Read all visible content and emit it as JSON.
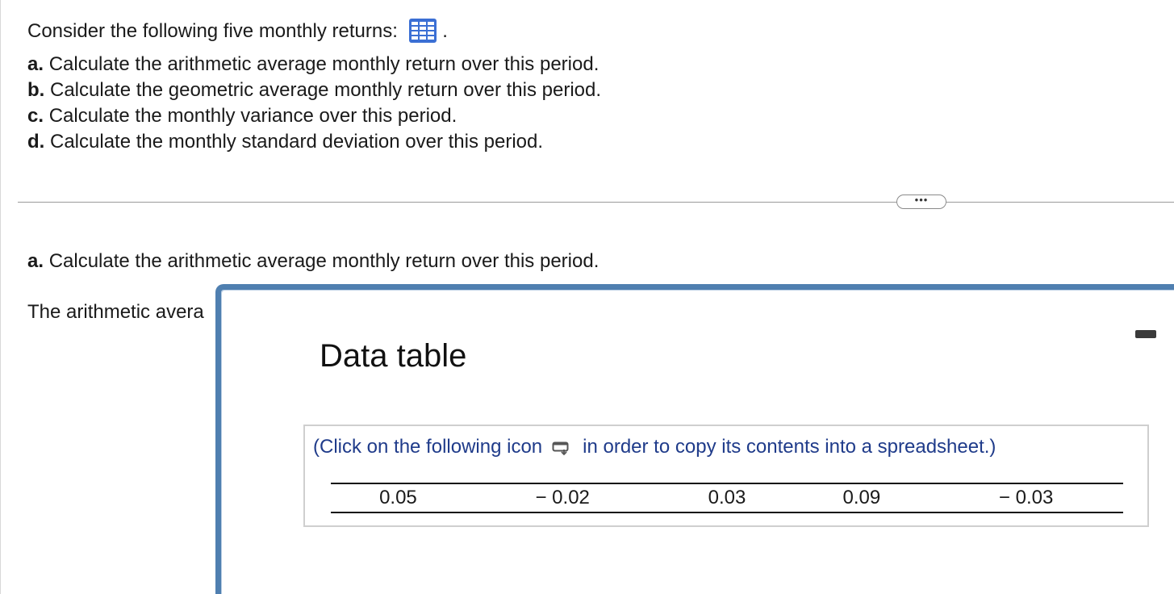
{
  "question": {
    "intro": "Consider the following five monthly returns:",
    "intro_suffix": ".",
    "parts": [
      {
        "letter": "a.",
        "text": "Calculate the arithmetic average monthly return over this period."
      },
      {
        "letter": "b.",
        "text": "Calculate the geometric average monthly return over this period."
      },
      {
        "letter": "c.",
        "text": "Calculate the monthly variance over this period."
      },
      {
        "letter": "d.",
        "text": "Calculate the monthly standard deviation over this period."
      }
    ]
  },
  "more_button": {
    "label": "•••"
  },
  "part_a": {
    "letter": "a.",
    "text": "Calculate the arithmetic average monthly return over this period."
  },
  "answer": {
    "prefix": "The arithmetic avera"
  },
  "popup": {
    "title": "Data table",
    "note_before": "(Click on the following icon",
    "note_after": "in order to copy its contents into a spreadsheet.)",
    "returns": [
      "0.05",
      "− 0.02",
      "0.03",
      "0.09",
      "− 0.03"
    ]
  },
  "colors": {
    "popup_border": "#4f7fb0",
    "note_text": "#1f3b8a",
    "table_icon": "#3b6fd4"
  },
  "icons": {
    "table": "table-grid-icon",
    "copy": "copy-spreadsheet-icon",
    "minimize": "minimize-icon"
  }
}
